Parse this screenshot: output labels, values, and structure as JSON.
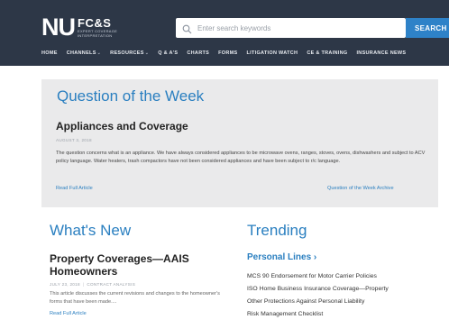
{
  "header": {
    "logo_main": "NU",
    "logo_brand": "FC&S",
    "logo_tagline_1": "EXPERT COVERAGE",
    "logo_tagline_2": "INTERPRETATION"
  },
  "search": {
    "placeholder": "Enter search keywords",
    "button_label": "SEARCH"
  },
  "nav": {
    "items": [
      {
        "label": "HOME"
      },
      {
        "label": "CHANNELS",
        "chevron": "⌄"
      },
      {
        "label": "RESOURCES",
        "chevron": "⌄"
      },
      {
        "label": "Q & A'S"
      },
      {
        "label": "CHARTS"
      },
      {
        "label": "FORMS"
      },
      {
        "label": "LITIGATION WATCH"
      },
      {
        "label": "CE & TRAINING"
      },
      {
        "label": "INSURANCE NEWS"
      }
    ]
  },
  "question_of_week": {
    "heading": "Question of the Week",
    "title": "Appliances and Coverage",
    "date": "AUGUST 3, 2018",
    "body": "The question concerns what is an appliance. We have always considered appliances to be microwave ovens, ranges, stoves, ovens, dishwashers and subject to ACV policy language. Water heaters, trash compactors have not been considered appliances and have been subject to r/c language.",
    "read_link": "Read Full Article",
    "archive_link": "Question of the Week Archive"
  },
  "whats_new": {
    "heading": "What's New",
    "title": "Property Coverages—AAIS Homeowners",
    "date": "JULY 23, 2018",
    "category": "CONTRACT ANALYSIS",
    "body": "This article discusses the current revisions and changes to the homeowner's forms that have been made....",
    "read_link": "Read Full Article"
  },
  "trending": {
    "heading": "Trending",
    "section": "Personal Lines ›",
    "items": [
      {
        "label": "MCS 90 Endorsement for Motor Carrier Policies"
      },
      {
        "label": "ISO Home Business Insurance Coverage—Property"
      },
      {
        "label": "Other Protections Against Personal Liability"
      },
      {
        "label": "Risk Management Checklist"
      }
    ]
  },
  "colors": {
    "header_bg": "#2d3747",
    "accent": "#2a7fc0",
    "search_button": "#2e82c8",
    "panel_bg": "#eaeaeb"
  },
  "icons": {
    "search": "search-icon"
  }
}
